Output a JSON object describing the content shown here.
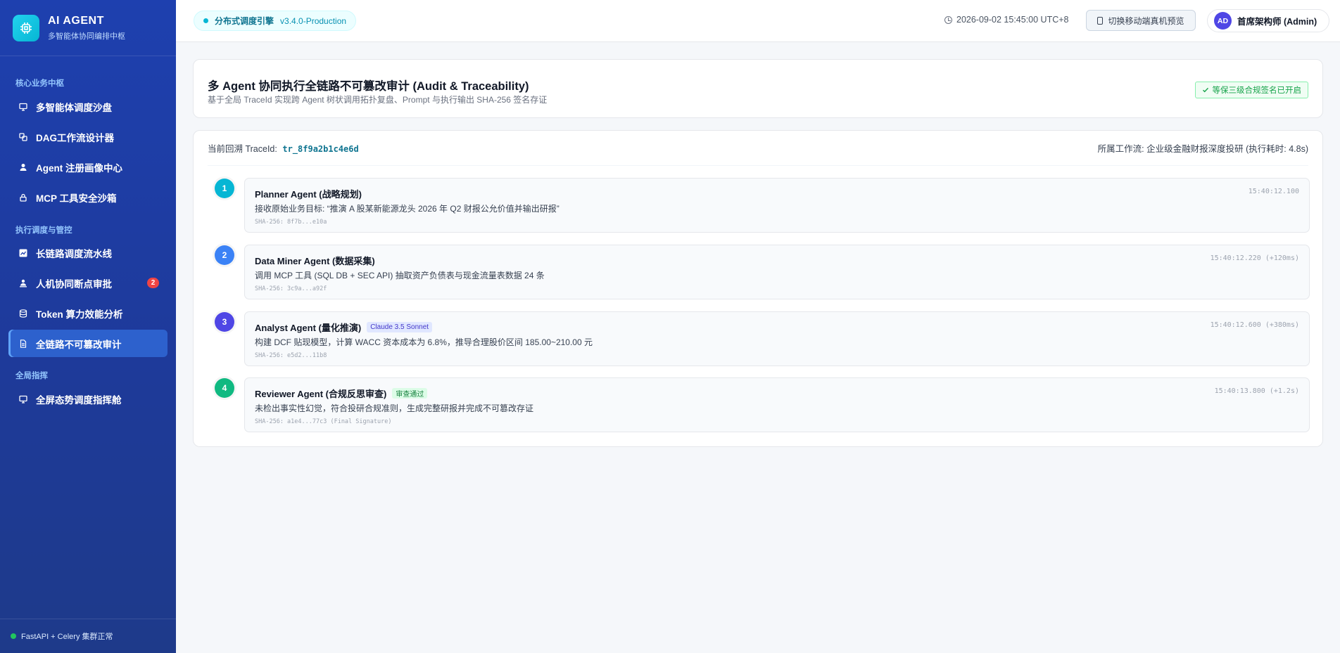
{
  "brand": {
    "title": "AI AGENT",
    "subtitle": "多智能体协同编排中枢"
  },
  "sidebar": {
    "sections": [
      {
        "label": "核心业务中枢"
      },
      {
        "label": "执行调度与管控"
      },
      {
        "label": "全局指挥"
      }
    ],
    "items": [
      {
        "label": "多智能体调度沙盘",
        "icon": "sandbox-icon"
      },
      {
        "label": "DAG工作流设计器",
        "icon": "dag-icon"
      },
      {
        "label": "Agent 注册画像中心",
        "icon": "user-icon"
      },
      {
        "label": "MCP 工具安全沙箱",
        "icon": "lock-icon"
      },
      {
        "label": "长链路调度流水线",
        "icon": "pipeline-icon"
      },
      {
        "label": "人机协同断点审批",
        "icon": "approval-icon",
        "badge": "2"
      },
      {
        "label": "Token 算力效能分析",
        "icon": "database-icon"
      },
      {
        "label": "全链路不可篡改审计",
        "icon": "document-icon",
        "active": true
      },
      {
        "label": "全屏态势调度指挥舱",
        "icon": "monitor-icon"
      }
    ],
    "footer": "FastAPI + Celery 集群正常"
  },
  "topbar": {
    "engine_name": "分布式调度引擎",
    "engine_version": "v3.4.0-Production",
    "datetime": "2026-09-02 15:45:00 UTC+8",
    "mobile_button": "切换移动端真机预览",
    "avatar_initials": "AD",
    "user_name": "首席架构师 (Admin)"
  },
  "header": {
    "title": "多 Agent 协同执行全链路不可篡改审计 (Audit & Traceability)",
    "subtitle": "基于全局 TraceId 实现跨 Agent 树状调用拓扑复盘、Prompt 与执行输出 SHA-256 签名存证",
    "compliance_badge": "等保三级合规签名已开启"
  },
  "trace": {
    "label": "当前回溯 TraceId:",
    "id": "tr_8f9a2b1c4e6d",
    "workflow": "所属工作流: 企业级金融财报深度投研 (执行耗时: 4.8s)",
    "steps": [
      {
        "num": "1",
        "color": "#06b6d4",
        "title": "Planner Agent (战略规划)",
        "tag": "",
        "desc": "接收原始业务目标: “推演 A 股某新能源龙头 2026 年 Q2 财报公允价值并输出研报”",
        "hash": "SHA-256: 8f7b...e10a",
        "time": "15:40:12.100"
      },
      {
        "num": "2",
        "color": "#3b82f6",
        "title": "Data Miner Agent (数据采集)",
        "tag": "",
        "desc": "调用 MCP 工具 (SQL DB + SEC API) 抽取资产负债表与现金流量表数据 24 条",
        "hash": "SHA-256: 3c9a...a92f",
        "time": "15:40:12.220 (+120ms)"
      },
      {
        "num": "3",
        "color": "#4f46e5",
        "title": "Analyst Agent (量化推演)",
        "tag": "Claude 3.5 Sonnet",
        "desc": "构建 DCF 贴现模型，计算 WACC 资本成本为 6.8%，推导合理股价区间 185.00~210.00 元",
        "hash": "SHA-256: e5d2...11b8",
        "time": "15:40:12.600 (+380ms)"
      },
      {
        "num": "4",
        "color": "#10b981",
        "title": "Reviewer Agent (合规反思审查)",
        "tag": "审查通过",
        "desc": "未检出事实性幻觉，符合投研合规准则，生成完整研报并完成不可篡改存证",
        "hash": "SHA-256: a1e4...77c3 (Final Signature)",
        "time": "15:40:13.800 (+1.2s)"
      }
    ]
  }
}
